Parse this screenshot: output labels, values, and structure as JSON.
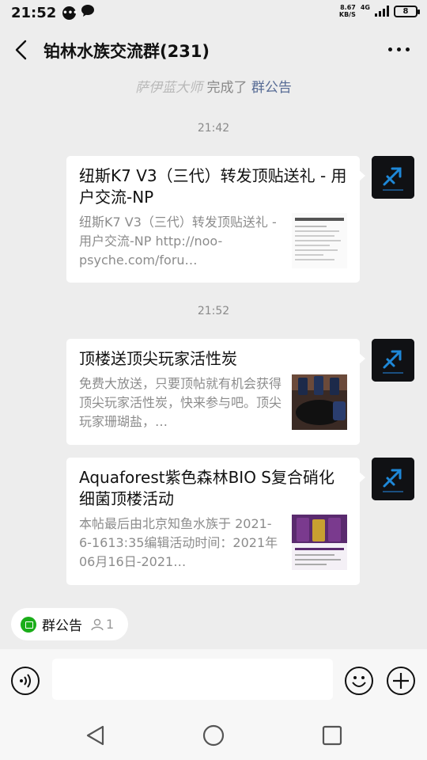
{
  "status_bar": {
    "time": "21:52",
    "net_speed_value": "8.67",
    "net_speed_unit": "KB/S",
    "network": "4G",
    "battery": "8"
  },
  "header": {
    "title": "铂林水族交流群(231)"
  },
  "system_notice": {
    "user": "萨伊蓝大师",
    "action": "完成了",
    "link": "群公告"
  },
  "timestamps": [
    "21:42",
    "21:52"
  ],
  "messages": [
    {
      "title": "纽斯K7 V3（三代）转发顶贴送礼 - 用户交流-NP",
      "desc": "纽斯K7 V3（三代）转发顶贴送礼 - 用户交流-NP http://noo-psyche.com/foru…"
    },
    {
      "title": "顶楼送顶尖玩家活性炭",
      "desc": "免费大放送，只要顶帖就有机会获得顶尖玩家活性炭，快来参与吧。顶尖玩家珊瑚盐，…"
    },
    {
      "title": "Aquaforest紫色森林BIO S复合硝化细菌顶楼活动",
      "desc": "本帖最后由北京知鱼水族于 2021-6-1613:35编辑活动时间：2021年06月16日-2021…"
    }
  ],
  "bottom": {
    "notice_label": "群公告",
    "notice_count": "1"
  }
}
